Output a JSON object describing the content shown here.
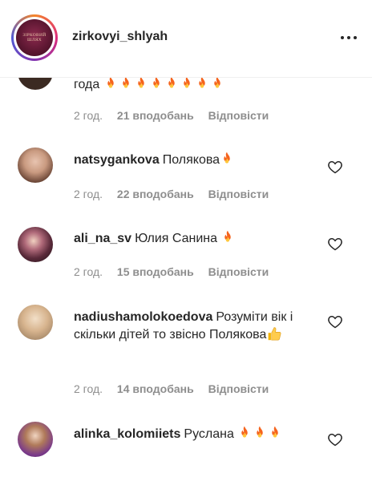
{
  "header": {
    "username": "zirkovyi_shlyah",
    "logo_text": "ЗІРКОВИЙ ШЛЯХ",
    "more_icon": "more-horizontal-icon"
  },
  "comments": [
    {
      "username": "",
      "text": "года",
      "fire_count": 8,
      "time": "2 год.",
      "likes": "21 вподобань",
      "reply": "Відповісти"
    },
    {
      "username": "natsygankova",
      "text": "Полякова",
      "fire_count": 1,
      "time": "2 год.",
      "likes": "22 вподобань",
      "reply": "Відповісти"
    },
    {
      "username": "ali_na_sv",
      "text": "Юлия Санина",
      "fire_count": 1,
      "time": "2 год.",
      "likes": "15 вподобань",
      "reply": "Відповісти"
    },
    {
      "username": "nadiushamolokoedova",
      "text": "Розуміти вік і скільки дітей то звісно Полякова",
      "thumbs": 1,
      "time": "2 год.",
      "likes": "14 вподобань",
      "reply": "Відповісти"
    },
    {
      "username": "alinka_kolomiiets",
      "text": "Руслана",
      "fire_count": 3,
      "time": "",
      "likes": "",
      "reply": ""
    }
  ],
  "colors": {
    "text": "#262626",
    "meta": "#8e8e8e",
    "fire": "#f5641e"
  }
}
